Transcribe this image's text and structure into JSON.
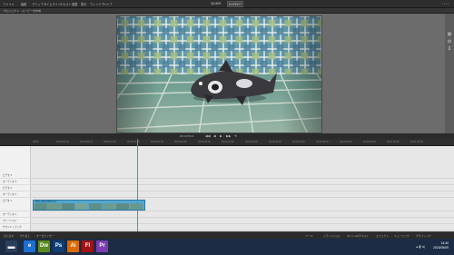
{
  "menubar": {
    "items": [
      "ファイル",
      "編集",
      "クリップ",
      "タイムライン",
      "テキスト",
      "調整",
      "表示",
      "ウィンドウ",
      "ヘルプ"
    ],
    "mode_tabs": [
      "QUICK",
      "EXPERT"
    ],
    "right_text": "▪ ▪ ▪ ▪"
  },
  "subbar": {
    "items": [
      "プロジェクト",
      "ムービーを作成"
    ]
  },
  "transport": {
    "timecode": "00;00;05;21",
    "buttons": [
      "◀◀",
      "◀",
      "▶",
      "▶▶",
      "⟲"
    ]
  },
  "ruler": {
    "ticks": [
      "00;00",
      "00;00;04;00",
      "00;00;08;00",
      "00;00;12;00",
      "00;00;16;00",
      "00;00;20;00",
      "00;00;24;00",
      "00;00;28;00",
      "00;00;32;00",
      "00;00;36;00",
      "00;00;40;00",
      "00;00;44;00",
      "00;00;48;00",
      "00;00;52;00",
      "00;00;56;00",
      "00;01;00;00",
      "00;01;04;00"
    ]
  },
  "tracks": [
    "ビデオ 3",
    "オーディオ 3",
    "ビデオ 2",
    "オーディオ 2",
    "ビデオ 1",
    "オーディオ 1",
    "ナレーション",
    "サウンドトラック"
  ],
  "clip": {
    "title": "IMG_0012.MOV [V]"
  },
  "bottombar": {
    "left": [
      "元に戻す",
      "やり直し",
      "オーガナイザー"
    ],
    "right": [
      "ツール",
      "トランジション",
      "タイトル&テキスト",
      "エフェクト",
      "ミュージック",
      "グラフィック"
    ]
  },
  "taskbar": {
    "apps": [
      {
        "label": "e",
        "color": "#1e6fd0"
      },
      {
        "label": "Dw",
        "color": "#5a8a1e"
      },
      {
        "label": "Ps",
        "color": "#0f3e78"
      },
      {
        "label": "Ai",
        "color": "#d96a00"
      },
      {
        "label": "Fl",
        "color": "#a01218"
      },
      {
        "label": "Pr",
        "color": "#7b3db0"
      }
    ],
    "time": "14:40",
    "date": "2015/05/09"
  }
}
